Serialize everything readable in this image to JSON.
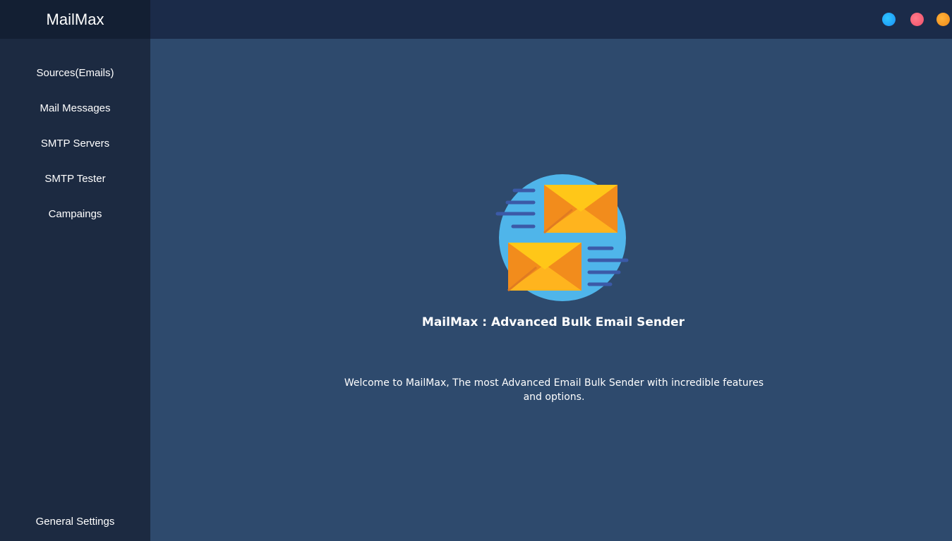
{
  "app": {
    "brand": "MailMax"
  },
  "sidebar": {
    "items": [
      {
        "label": "Sources(Emails)"
      },
      {
        "label": "Mail Messages"
      },
      {
        "label": "SMTP Servers"
      },
      {
        "label": "SMTP Tester"
      },
      {
        "label": "Campaings"
      }
    ],
    "bottom_item": {
      "label": "General Settings"
    }
  },
  "window_controls": [
    {
      "name": "blue-dot",
      "color": "#1a8ff7"
    },
    {
      "name": "red-dot",
      "color": "#f0506a"
    },
    {
      "name": "orange-dot",
      "color": "#f08a18"
    }
  ],
  "main": {
    "icon": "envelopes-icon",
    "title": "MailMax : Advanced Bulk Email Sender",
    "description": "Welcome to MailMax, The most Advanced Email Bulk Sender with incredible features and options."
  },
  "colors": {
    "sidebar_bg": "#1c2a41",
    "brand_bg": "#131f33",
    "topbar_bg": "#1b2b49",
    "main_bg": "#2e4a6d",
    "icon_circle": "#4fb5ea",
    "envelope_light": "#ffc718",
    "envelope_dark": "#f28c1c",
    "speed_lines": "#3b5aa8"
  }
}
